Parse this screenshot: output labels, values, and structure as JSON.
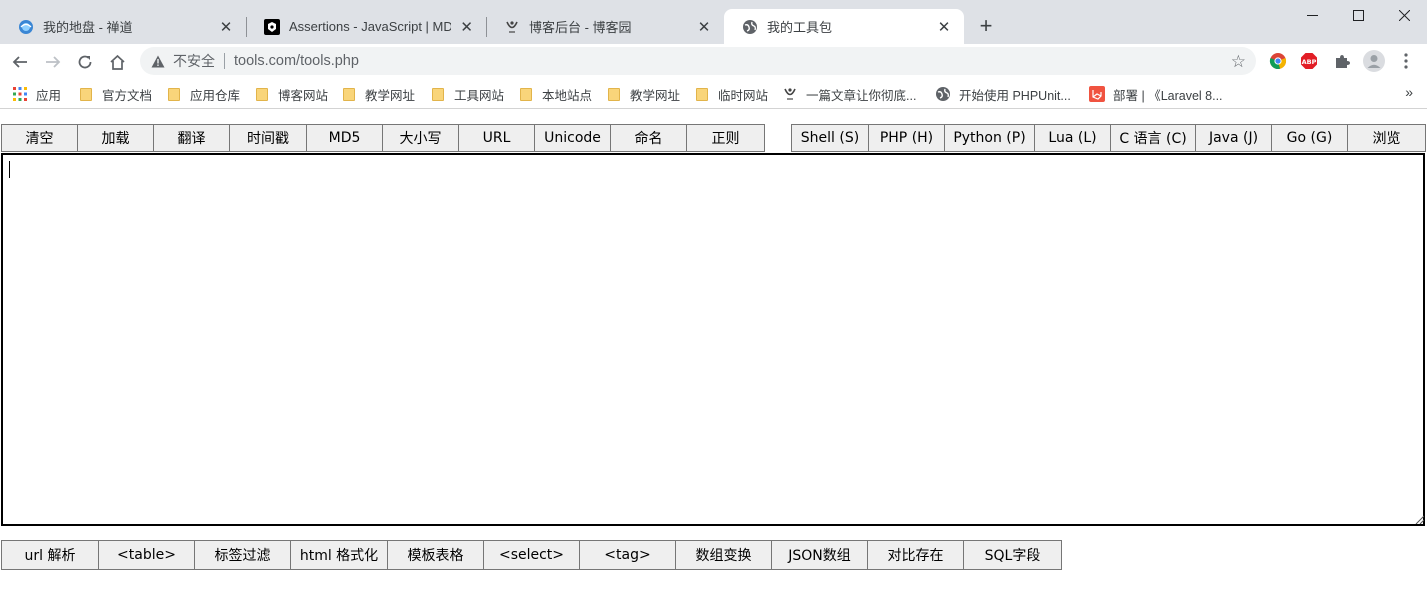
{
  "tabs": [
    {
      "title": "我的地盘 - 禅道",
      "icon": "zentao-icon"
    },
    {
      "title": "Assertions - JavaScript | MDN",
      "icon": "mdn-icon"
    },
    {
      "title": "博客后台 - 博客园",
      "icon": "cnblogs-icon"
    },
    {
      "title": "我的工具包",
      "icon": "globe-icon",
      "active": true
    }
  ],
  "new_tab_symbol": "+",
  "window_controls": {
    "minimize": "—",
    "maximize": "☐",
    "close": "✕"
  },
  "toolbar": {
    "security_label": "不安全",
    "url": "tools.com/tools.php"
  },
  "bookmarks": [
    {
      "label": "应用",
      "icon": "apps-grid-icon"
    },
    {
      "label": "官方文档",
      "icon": "folder-icon"
    },
    {
      "label": "应用仓库",
      "icon": "folder-icon"
    },
    {
      "label": "博客网站",
      "icon": "folder-icon"
    },
    {
      "label": "教学网址",
      "icon": "folder-icon"
    },
    {
      "label": "工具网站",
      "icon": "folder-icon"
    },
    {
      "label": "本地站点",
      "icon": "folder-icon"
    },
    {
      "label": "教学网址",
      "icon": "folder-icon"
    },
    {
      "label": "临时网站",
      "icon": "folder-icon"
    },
    {
      "label": "一篇文章让你彻底...",
      "icon": "cnblogs-icon"
    },
    {
      "label": "开始使用 PHPUnit...",
      "icon": "globe-icon"
    },
    {
      "label": "部署 | 《Laravel 8...",
      "icon": "laravel-icon"
    }
  ],
  "bookmarks_more": "»",
  "top_tools_left": [
    "清空",
    "加载",
    "翻译",
    "时间戳",
    "MD5",
    "大小写",
    "URL",
    "Unicode",
    "命名",
    "正则"
  ],
  "top_tools_right": [
    "Shell (S)",
    "PHP (H)",
    "Python (P)",
    "Lua (L)",
    "C 语言 (C)",
    "Java (J)",
    "Go (G)",
    "浏览"
  ],
  "editor": {
    "value": ""
  },
  "bottom_tools": [
    "url 解析",
    "<table>",
    "标签过滤",
    "html 格式化",
    "模板表格",
    "<select>",
    "<tag>",
    "数组变换",
    "JSON数组",
    "对比存在",
    "SQL字段"
  ],
  "colors": {
    "tabstrip_bg": "#dee1e6",
    "omnibox_bg": "#f1f3f4",
    "button_bg": "#efefef",
    "button_border": "#767676"
  }
}
